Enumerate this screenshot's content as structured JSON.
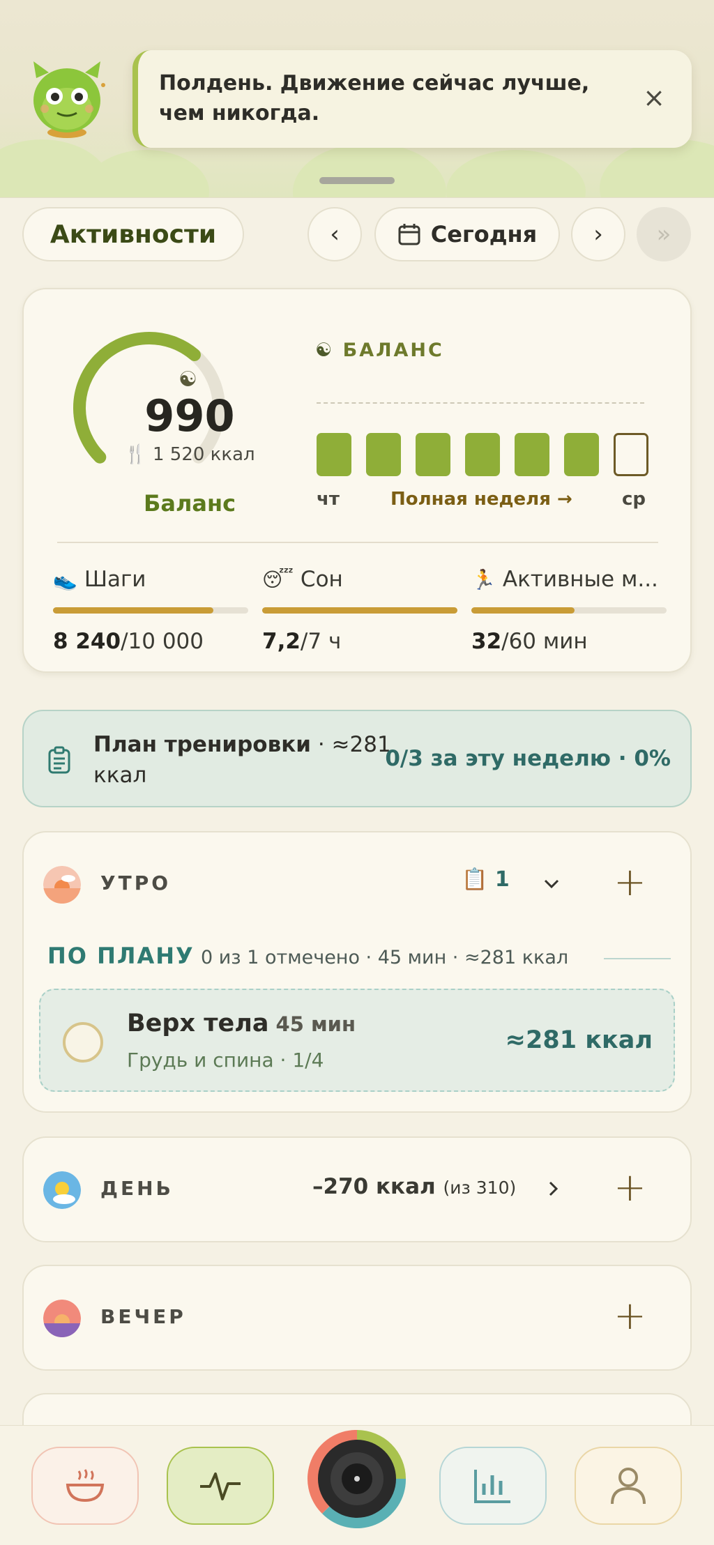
{
  "toast": {
    "message": "Полдень. Движение сейчас лучше, чем никогда.",
    "close_icon": "×"
  },
  "header": {
    "section_label": "Активности",
    "prev_icon": "‹",
    "date_label": "Сегодня",
    "next_icon": "›",
    "jump_icon": "»"
  },
  "summary": {
    "balance_value": "990",
    "intake_label": "1 520 ккал",
    "gauge_label": "Баланс",
    "gauge_fraction": 0.65,
    "balance_title": "БАЛАНС",
    "week_start": "чт",
    "week_link": "Полная неделя →",
    "week_end": "ср",
    "week_filled": [
      true,
      true,
      true,
      true,
      true,
      true,
      false
    ],
    "metrics": [
      {
        "name": "Шаги",
        "icon": "sneaker-icon",
        "value": "8 240",
        "goal": "/10 000",
        "progress": 0.82
      },
      {
        "name": "Сон",
        "icon": "sleepy-face-icon",
        "value": "7,2",
        "goal": "/7 ч",
        "progress": 1.0
      },
      {
        "name": "Активные м...",
        "icon": "runner-icon",
        "value": "32",
        "goal": "/60 мин",
        "progress": 0.53
      }
    ]
  },
  "plan": {
    "title": "План тренировки",
    "title_suffix": " · ≈281 ккал",
    "stat": "0/3 за эту неделю · 0%"
  },
  "morning": {
    "title": "УТРО",
    "count": "1",
    "plan_header": "ПО ПЛАНУ",
    "plan_meta": "0 из 1 отмечено · 45 мин · ≈281 ккал",
    "workout": {
      "name": "Верх тела",
      "duration": "45 мин",
      "detail": "Грудь и спина · 1/4",
      "kcal": "≈281 ккал"
    }
  },
  "day": {
    "title": "ДЕНЬ",
    "kcal": "–270 ккал",
    "of": "(из 310)"
  },
  "evening": {
    "title": "ВЕЧЕР"
  },
  "colors": {
    "accent": "#8fae38",
    "gold": "#c99c36",
    "teal": "#2f7a72"
  }
}
